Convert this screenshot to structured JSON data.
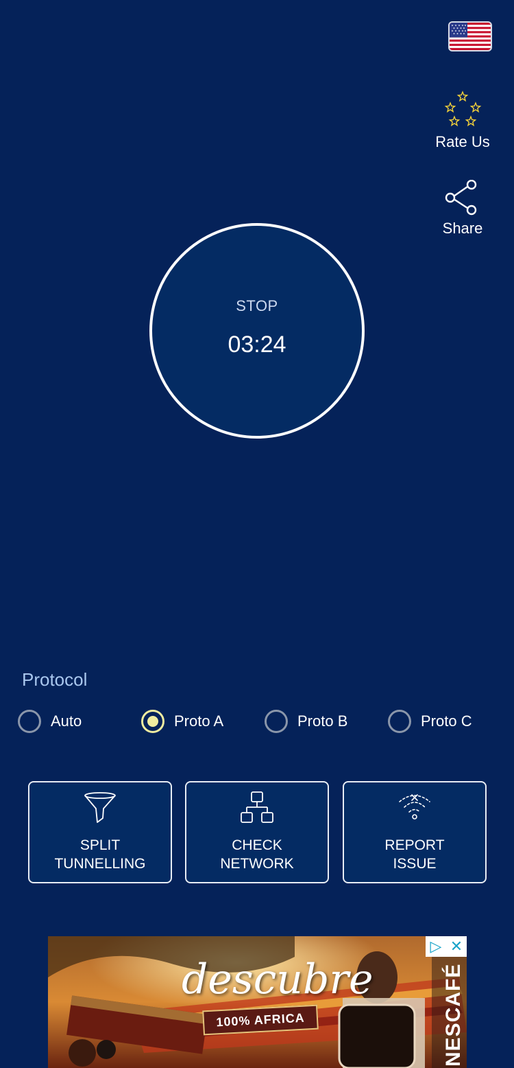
{
  "top_right": {
    "flag_icon": "us-flag-icon",
    "rate_label": "Rate Us",
    "rate_icon": "stars-icon",
    "share_label": "Share",
    "share_icon": "share-icon"
  },
  "connection": {
    "status_label": "STOP",
    "timer": "03:24"
  },
  "protocol": {
    "title": "Protocol",
    "options": [
      {
        "label": "Auto",
        "selected": false
      },
      {
        "label": "Proto A",
        "selected": true
      },
      {
        "label": "Proto B",
        "selected": false
      },
      {
        "label": "Proto C",
        "selected": false
      }
    ]
  },
  "actions": [
    {
      "label_line1": "SPLIT",
      "label_line2": "TUNNELLING",
      "icon": "funnel-icon"
    },
    {
      "label_line1": "CHECK",
      "label_line2": "NETWORK",
      "icon": "network-icon"
    },
    {
      "label_line1": "REPORT",
      "label_line2": "ISSUE",
      "icon": "wifi-error-icon"
    }
  ],
  "ad": {
    "headline": "descubre",
    "badge": "100% AFRICA",
    "brand": "NESCAFÉ",
    "close_symbol": "✕",
    "adchoices_symbol": "▷"
  },
  "colors": {
    "background": "#052259",
    "accent": "#f0eca0",
    "protocol_title": "#a9c7ee"
  }
}
